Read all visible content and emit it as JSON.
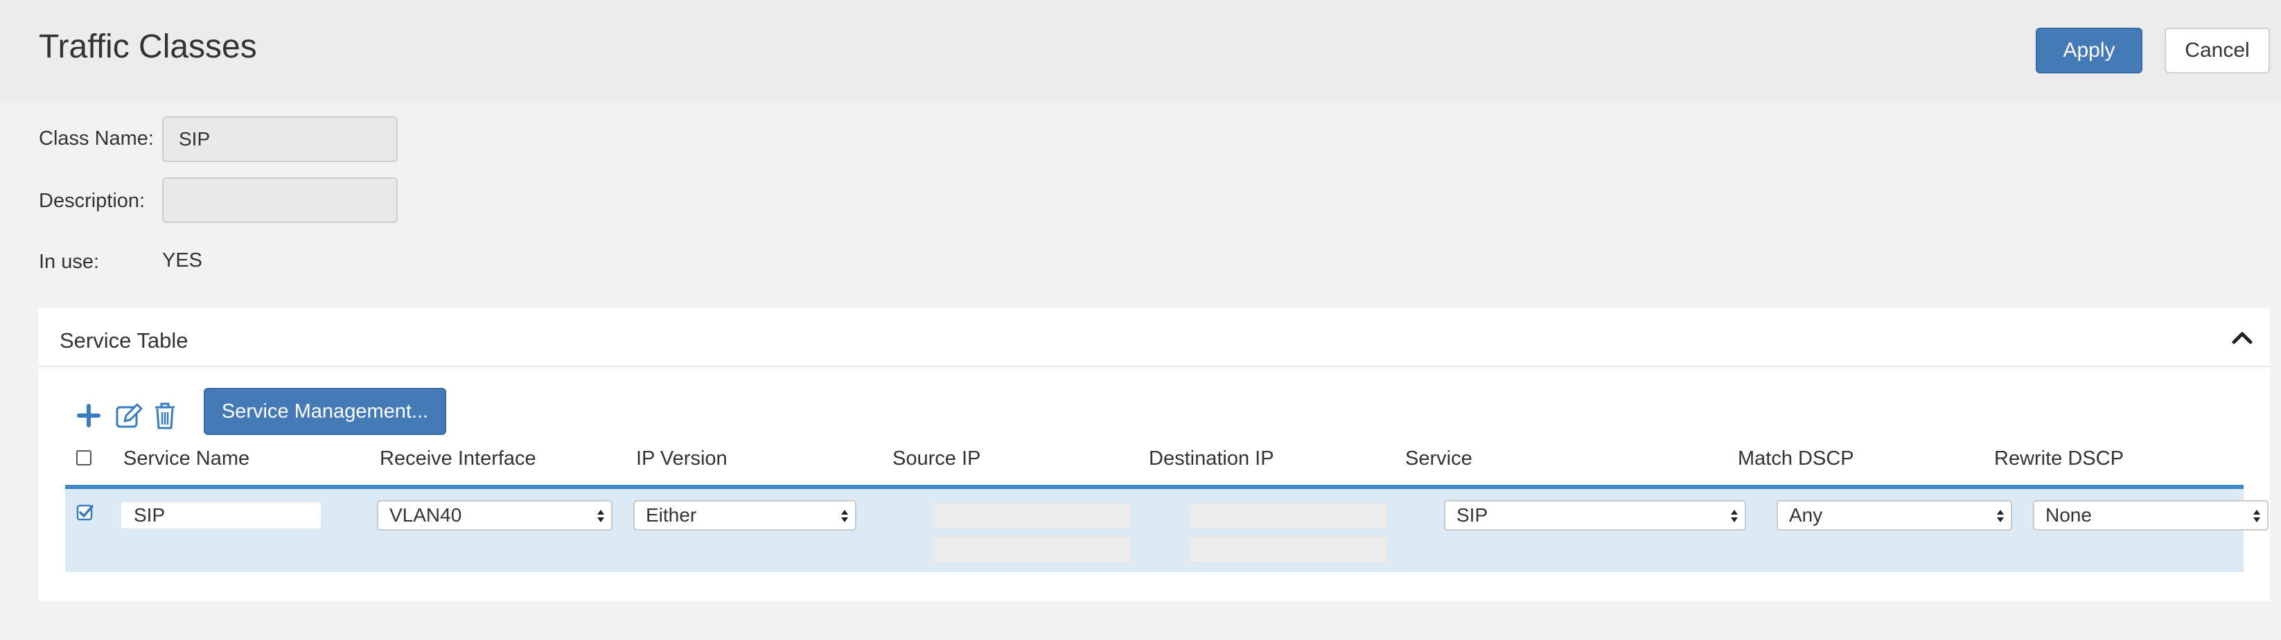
{
  "header": {
    "title": "Traffic Classes",
    "apply_label": "Apply",
    "cancel_label": "Cancel"
  },
  "form": {
    "class_name_label": "Class Name:",
    "class_name_value": "SIP",
    "description_label": "Description:",
    "description_value": "",
    "in_use_label": "In use:",
    "in_use_value": "YES"
  },
  "service_table": {
    "title": "Service Table",
    "service_management_label": "Service Management...",
    "columns": [
      "Service Name",
      "Receive Interface",
      "IP Version",
      "Source IP",
      "Destination IP",
      "Service",
      "Match DSCP",
      "Rewrite DSCP"
    ],
    "rows": [
      {
        "checked": true,
        "service_name": "SIP",
        "receive_interface": "VLAN40",
        "ip_version": "Either",
        "source_ip": "",
        "destination_ip": "",
        "service": "SIP",
        "match_dscp": "Any",
        "rewrite_dscp": "None"
      }
    ]
  },
  "colors": {
    "primary": "#447ab6",
    "row_selected": "#dbeaf5",
    "row_accent": "#3f88c5",
    "icon": "#3a7cc0"
  },
  "icons": [
    "plus-icon",
    "edit-icon",
    "trash-icon",
    "chevron-up-icon",
    "checkbox-checked-icon"
  ]
}
